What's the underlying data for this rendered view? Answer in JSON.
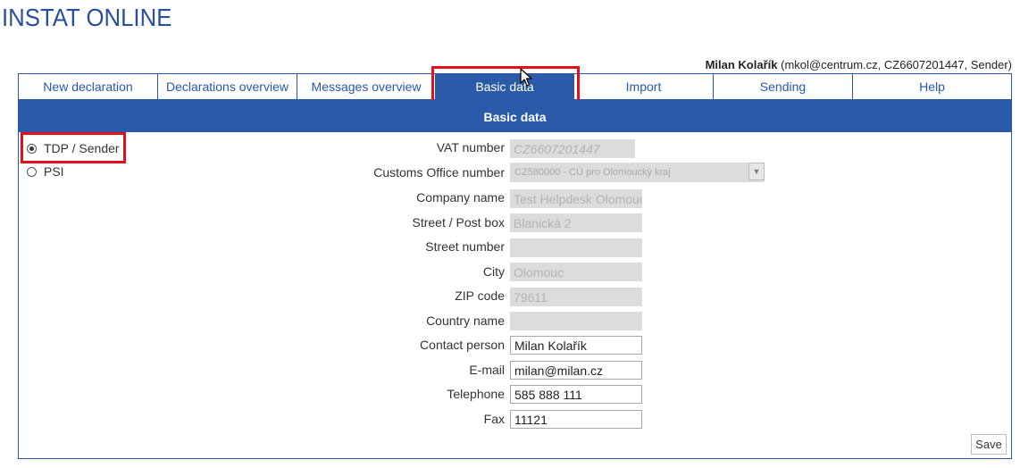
{
  "app_title": "INSTAT ONLINE",
  "user": {
    "name": "Milan Kolařík",
    "details": "(mkol@centrum.cz, CZ6607201447, Sender)"
  },
  "tabs": [
    {
      "label": "New declaration"
    },
    {
      "label": "Declarations overview"
    },
    {
      "label": "Messages overview"
    },
    {
      "label": "Basic data",
      "active": true
    },
    {
      "label": "Import"
    },
    {
      "label": "Sending"
    },
    {
      "label": "Help"
    }
  ],
  "panel": {
    "title": "Basic data"
  },
  "roles": [
    {
      "label": "TDP / Sender",
      "selected": true
    },
    {
      "label": "PSI",
      "selected": false
    }
  ],
  "form": {
    "vat_number": {
      "label": "VAT number",
      "value": "CZ6607201447"
    },
    "customs_office": {
      "label": "Customs Office number",
      "value": "CZ580000 - CÚ pro Olomoucký kraj"
    },
    "company_name": {
      "label": "Company name",
      "value": "Test Helpdesk Olomouc"
    },
    "street": {
      "label": "Street / Post box",
      "value": "Blanická 2"
    },
    "street_number": {
      "label": "Street number",
      "value": ""
    },
    "city": {
      "label": "City",
      "value": "Olomouc"
    },
    "zip": {
      "label": "ZIP code",
      "value": "79611"
    },
    "country": {
      "label": "Country name",
      "value": ""
    },
    "contact_person": {
      "label": "Contact person",
      "value": "Milan Kolařík"
    },
    "email": {
      "label": "E-mail",
      "value": "milan@milan.cz"
    },
    "telephone": {
      "label": "Telephone",
      "value": "585 888 111"
    },
    "fax": {
      "label": "Fax",
      "value": "11121"
    }
  },
  "save_label": "Save",
  "colors": {
    "brand": "#2a4ea0",
    "tab_active": "#2b5ba8",
    "highlight": "#e3101c",
    "disabled_field": "#dcdcdc"
  }
}
